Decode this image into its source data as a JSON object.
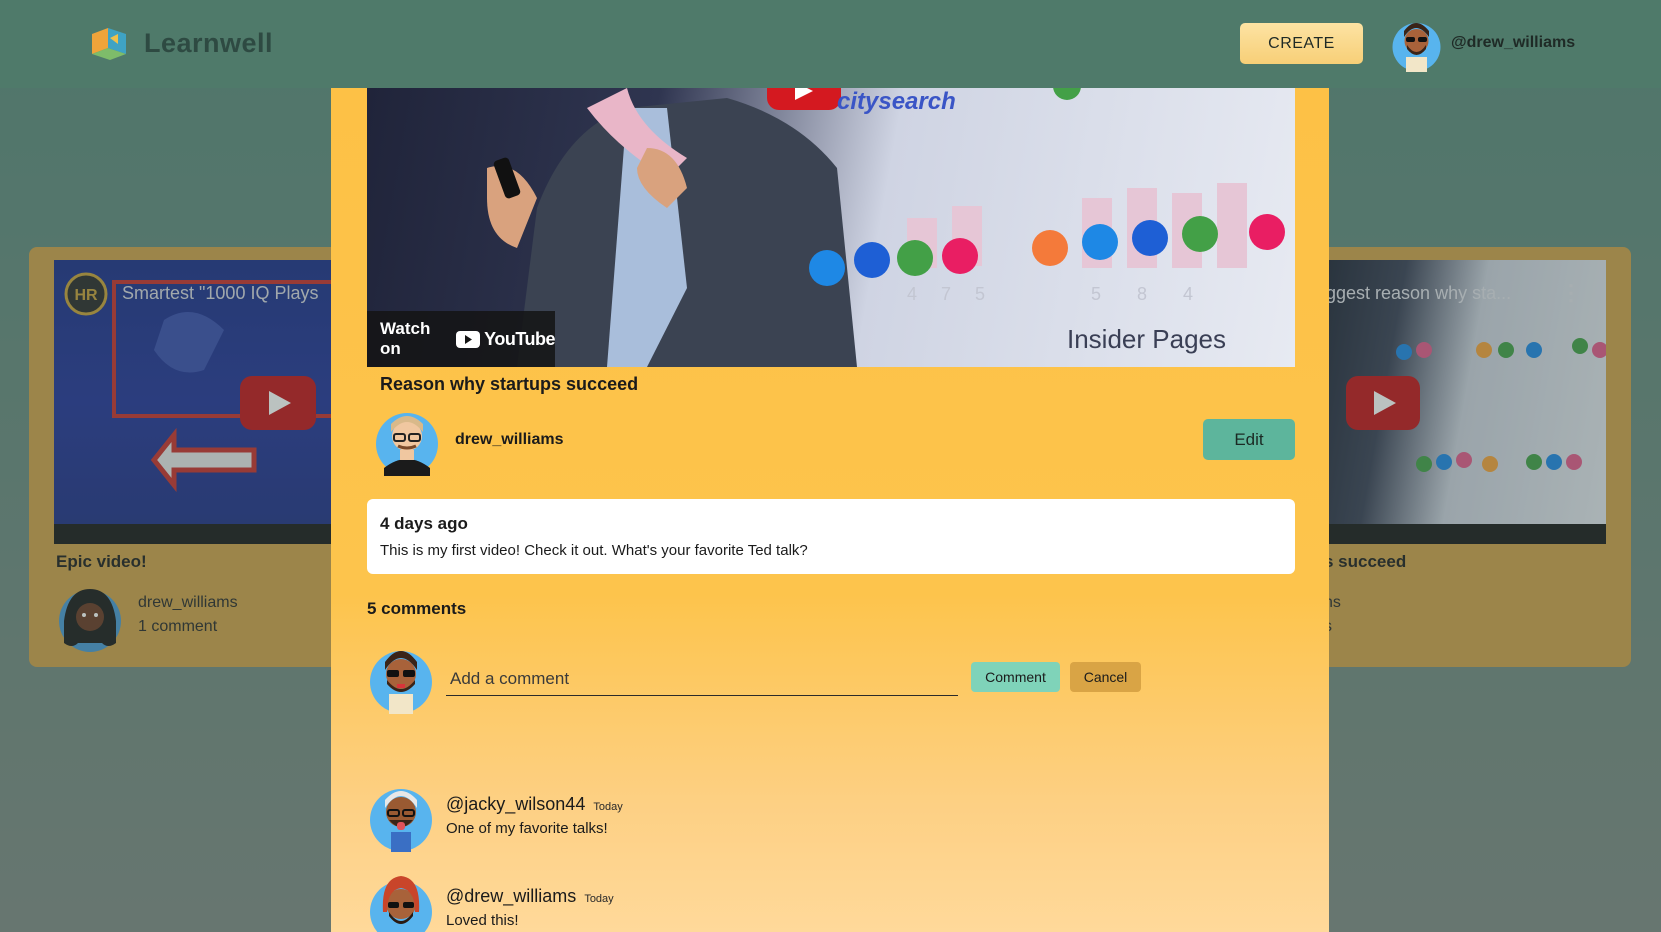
{
  "header": {
    "app_name": "Learnwell",
    "create_label": "CREATE",
    "user_handle": "@drew_williams"
  },
  "background_cards": [
    {
      "video_title": "Smartest \"1000 IQ Plays",
      "title": "Epic video!",
      "author": "drew_williams",
      "comments": "1 comment"
    },
    {
      "video_title": "iggest reason why sta...",
      "title": "s succeed",
      "author": "ns",
      "comments": "s"
    }
  ],
  "modal": {
    "video": {
      "watch_on": "Watch on",
      "youtube": "YouTube",
      "overlay_texts": [
        "citysearch",
        "Insider Pages"
      ],
      "chart_digits": [
        "4",
        "7",
        "5",
        "5",
        "8",
        "4"
      ]
    },
    "title": "Reason why startups succeed",
    "author": "drew_williams",
    "edit_label": "Edit",
    "description": {
      "date": "4 days ago",
      "text": "This is my first video! Check it out. What's your favorite Ted talk?"
    },
    "comments_count": "5 comments",
    "comment_input": {
      "placeholder": "Add a comment",
      "value": ""
    },
    "comment_button": "Comment",
    "cancel_button": "Cancel",
    "comments": [
      {
        "user": "@jacky_wilson44",
        "time": "Today",
        "text": "One of my favorite talks!"
      },
      {
        "user": "@drew_williams",
        "time": "Today",
        "text": "Loved this!"
      }
    ]
  },
  "colors": {
    "header_bg": "#4f7a6a",
    "modal_bg": "#fdc146",
    "create_btn": "#f7cf77",
    "edit_btn": "#5db59c",
    "comment_btn": "#7fd3b9",
    "cancel_btn": "#d9a445"
  }
}
